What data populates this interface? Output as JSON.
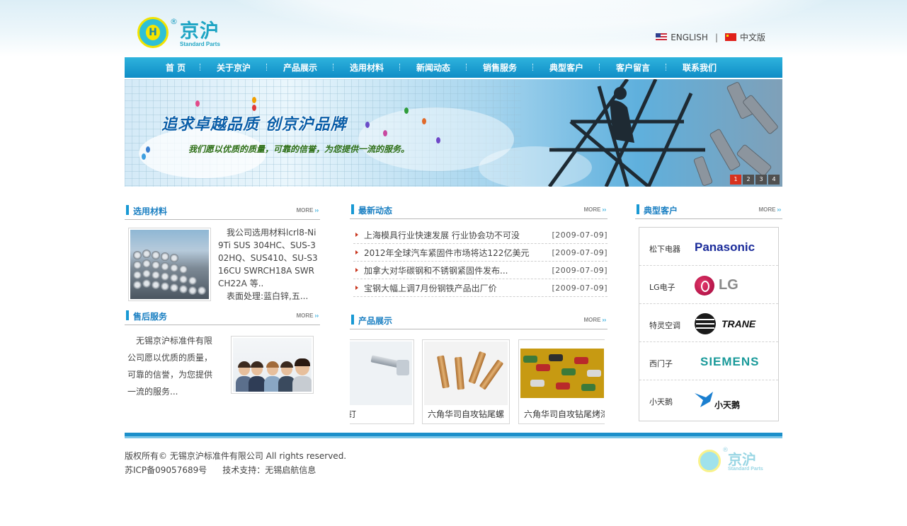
{
  "header": {
    "logo_cn": "京沪",
    "logo_en": "Standard Parts",
    "logo_reg": "®",
    "lang_english": "ENGLISH",
    "lang_separator": "|",
    "lang_chinese": "中文版"
  },
  "nav": {
    "items": [
      "首  页",
      "关于京沪",
      "产品展示",
      "选用材料",
      "新闻动态",
      "销售服务",
      "典型客户",
      "客户留言",
      "联系我们"
    ]
  },
  "banner": {
    "headline": "追求卓越品质 创京沪品牌",
    "subline": "我们愿以优质的质量，可靠的信誉，为您提供一流的服务。",
    "slides": [
      "1",
      "2",
      "3",
      "4"
    ],
    "active_slide": 1
  },
  "materials": {
    "title": "选用材料",
    "more": "MORE",
    "text": "我公司选用材料lcrl8-Ni9Ti SUS 304HC、SUS-302HQ、SUS410、SU-S316CU SWRCH18A SWRCH22A 等..",
    "text2": "表面处理:蓝白锌,五..."
  },
  "service": {
    "title": "售后服务",
    "more": "MORE",
    "text": "无锡京沪标准件有限公司愿以优质的质量，可靠的信誉，为您提供一流的服务..."
  },
  "news": {
    "title": "最新动态",
    "more": "MORE",
    "items": [
      {
        "title": "上海模具行业快速发展 行业协会功不可没",
        "date": "[2009-07-09]"
      },
      {
        "title": "2012年全球汽车紧固件市场将达122亿美元",
        "date": "[2009-07-09]"
      },
      {
        "title": "加拿大对华碳钢和不锈钢紧固件发布...",
        "date": "[2009-07-09]"
      },
      {
        "title": "宝钢大幅上调7月份钢铁产品出厂价",
        "date": "[2009-07-09]"
      }
    ]
  },
  "products": {
    "title": "产品展示",
    "more": "MORE",
    "items": [
      {
        "caption": "六角头带垫自钻钉"
      },
      {
        "caption": "六角华司自攻钻尾螺"
      },
      {
        "caption": "六角华司自攻钻尾烤漆"
      }
    ]
  },
  "clients": {
    "title": "典型客户",
    "more": "MORE",
    "items": [
      {
        "name": "松下电器",
        "brand": "Panasonic",
        "brand_color": "#1a2b9a"
      },
      {
        "name": "LG电子",
        "brand": "LG",
        "brand_color": "#8a8a8a"
      },
      {
        "name": "特灵空调",
        "brand": "TRANE",
        "brand_color": "#111111"
      },
      {
        "name": "西门子",
        "brand": "SIEMENS",
        "brand_color": "#1a9a9a"
      },
      {
        "name": "小天鹅",
        "brand": "小天鹅",
        "brand_color": "#1a5fb0"
      }
    ]
  },
  "footer": {
    "copyright": "版权所有© 无锡京沪标准件有限公司  All rights reserved.",
    "icp": "苏ICP备09057689号",
    "support": "技术支持：无锡启航信息"
  },
  "colors": {
    "nav_blue": "#1899d4",
    "title_blue": "#1a7fc2",
    "news_arrow": "#c8341c",
    "active_slide": "#d8321e"
  }
}
